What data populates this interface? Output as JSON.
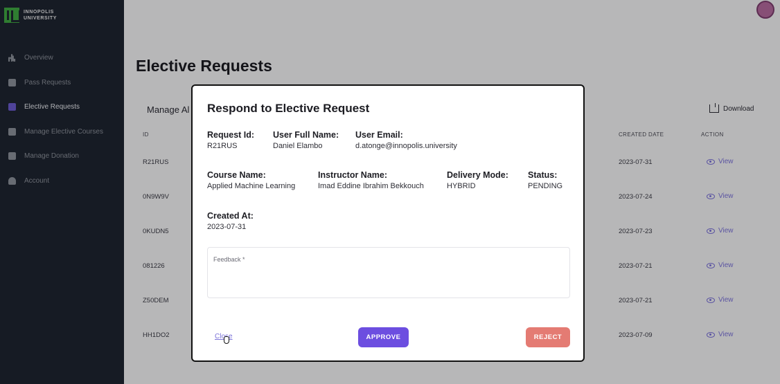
{
  "app": {
    "logo_line1": "INNOPOLIS",
    "logo_line2": "UNIVERSITY"
  },
  "sidebar": {
    "items": [
      {
        "label": "Overview",
        "icon": "chart-bar-icon",
        "active": false
      },
      {
        "label": "Pass Requests",
        "icon": "card-icon",
        "active": false
      },
      {
        "label": "Elective Requests",
        "icon": "briefcase-icon",
        "active": true
      },
      {
        "label": "Manage Elective Courses",
        "icon": "image-icon",
        "active": false
      },
      {
        "label": "Manage Donation",
        "icon": "image-icon",
        "active": false
      },
      {
        "label": "Account",
        "icon": "user-icon",
        "active": false
      }
    ]
  },
  "main": {
    "title": "Elective Requests",
    "section_label": "Manage Al",
    "download_label": "Download",
    "table": {
      "headers": {
        "id": "ID",
        "created": "CREATED DATE",
        "action": "ACTION"
      },
      "rows": [
        {
          "id": "R21RUS",
          "date": "2023-07-31",
          "action": "View"
        },
        {
          "id": "0N9W9V",
          "date": "2023-07-24",
          "action": "View"
        },
        {
          "id": "0KUDN5",
          "date": "2023-07-23",
          "action": "View"
        },
        {
          "id": "081226",
          "date": "2023-07-21",
          "action": "View"
        },
        {
          "id": "Z50DEM",
          "date": "2023-07-21",
          "action": "View"
        },
        {
          "id": "HH1DO2",
          "date": "2023-07-09",
          "action": "View"
        }
      ]
    }
  },
  "modal": {
    "title": "Respond to Elective Request",
    "request_id_label": "Request Id:",
    "request_id": "R21RUS",
    "user_name_label": "User Full Name:",
    "user_name": "Daniel Elambo",
    "user_email_label": "User Email:",
    "user_email": "d.atonge@innopolis.university",
    "course_label": "Course Name:",
    "course": "Applied Machine Learning",
    "instructor_label": "Instructor Name:",
    "instructor": "Imad Eddine Ibrahim Bekkouch",
    "delivery_label": "Delivery Mode:",
    "delivery": "HYBRID",
    "status_label": "Status:",
    "status": "PENDING",
    "created_label": "Created At:",
    "created": "2023-07-31",
    "feedback_label": "Feedback *",
    "close_label": "Close",
    "approve_label": "APPROVE",
    "reject_label": "REJECT"
  }
}
